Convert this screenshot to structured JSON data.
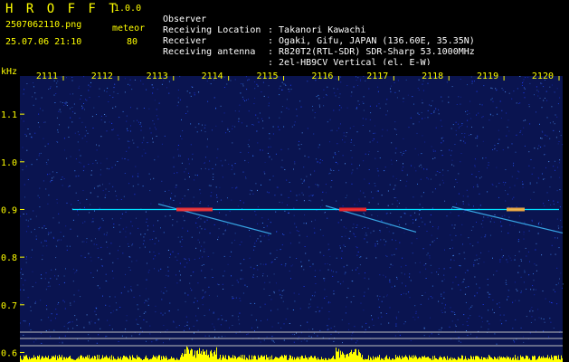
{
  "header": {
    "logo": "H R O F F T",
    "version": "1.0.0",
    "filename": "2507062110.png",
    "meteor_label": "meteor",
    "datetime": "25.07.06 21:10",
    "meteor_count": "80",
    "info": [
      {
        "label": "Observer",
        "value": ": Takanori Kawachi"
      },
      {
        "label": "Receiving Location",
        "value": ": Ogaki, Gifu, JAPAN (136.60E, 35.35N)"
      },
      {
        "label": "Receiver",
        "value": ": R820T2(RTL-SDR) SDR-Sharp 53.1000MHz"
      },
      {
        "label": "Receiving antenna",
        "value": ": 2el-HB9CV Vertical (el. E-W)"
      }
    ]
  },
  "chart_data": {
    "type": "heatmap",
    "ylabel": "kHz",
    "x_ticks": [
      "2111",
      "2112",
      "2113",
      "2114",
      "2115",
      "2116",
      "2117",
      "2118",
      "2119",
      "2120"
    ],
    "y_ticks": [
      "1.1",
      "1.0",
      "0.9",
      "0.8",
      "0.7",
      "0.6"
    ],
    "ylim": [
      0.58,
      1.18
    ],
    "carrier_khz": 0.9,
    "colors": {
      "background": "#0a1450",
      "tick": "#ffff00",
      "carrier": "#00e0ff",
      "signal": "#ffff00"
    }
  }
}
